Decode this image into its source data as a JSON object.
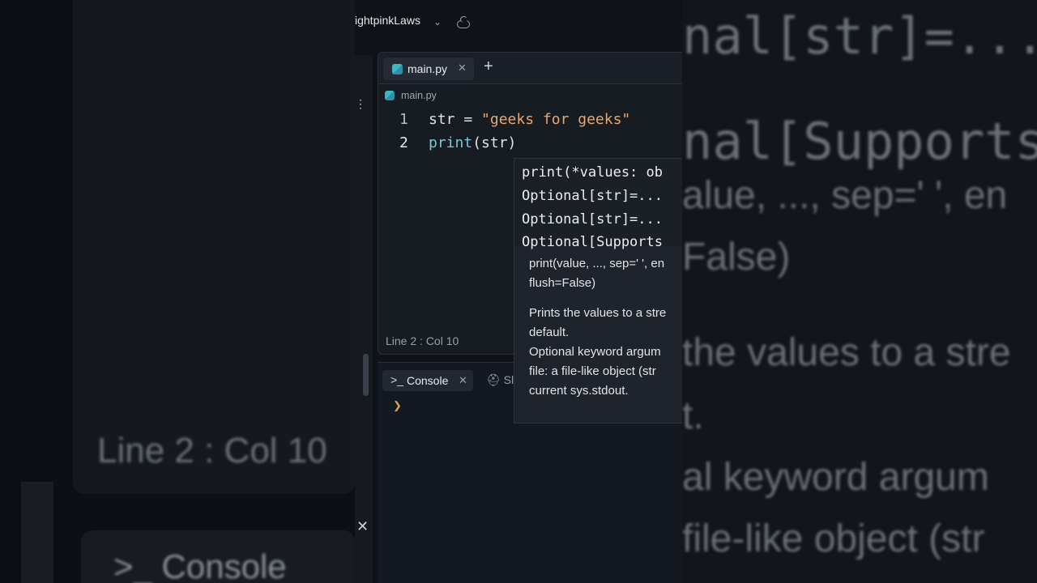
{
  "header": {
    "project_name": "ightpinkLaws"
  },
  "editor": {
    "tab_label": "main.py",
    "breadcrumb": "main.py",
    "lines": [
      {
        "num": "1",
        "parts": [
          {
            "t": "str = ",
            "c": ""
          },
          {
            "t": "\"geeks for geeks\"",
            "c": "str"
          }
        ]
      },
      {
        "num": "2",
        "parts": [
          {
            "t": "print",
            "c": "fn"
          },
          {
            "t": "(str)",
            "c": ""
          }
        ]
      }
    ],
    "status": "Line 2 : Col 10"
  },
  "autocomplete": {
    "signature_lines": [
      "print(*values: ob",
      "Optional[str]=...",
      "Optional[str]=...",
      "Optional[Supports"
    ],
    "doc_sig_1": "print(value, ..., sep=' ', en",
    "doc_sig_2": "flush=False)",
    "doc_line_1": "Prints the values to a stre",
    "doc_line_2": "default.",
    "doc_line_3": "Optional keyword argum",
    "doc_line_4": "file:  a file-like object (str",
    "doc_line_5": "current sys.stdout."
  },
  "console": {
    "tab_label": "Console",
    "shell_label": "Sl"
  },
  "background": {
    "left_status": "Line 2 : Col 10",
    "left_console": ">_ Console",
    "right_lines": [
      "nal[str]=...",
      "nal[Supports",
      "alue, ..., sep=' ', en",
      "False)",
      "the values to a stre",
      "t.",
      "al keyword argum",
      "file-like object (str"
    ]
  }
}
